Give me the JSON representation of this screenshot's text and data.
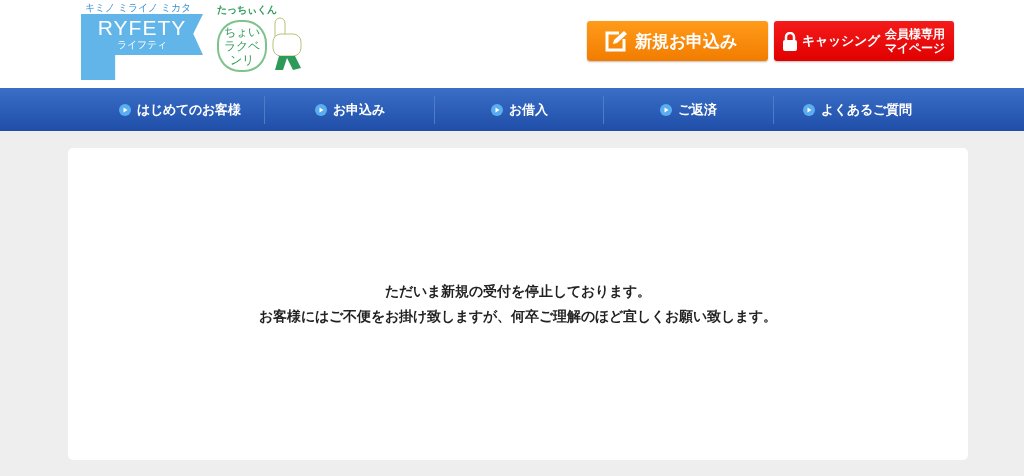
{
  "logo": {
    "tagline": "キミノ ミライノ ミカタ",
    "wordmark": "RYFETY",
    "kana": "ライフティ"
  },
  "mascot": {
    "name": "たっちぃくん",
    "speech": "ちょいラクベンリ"
  },
  "header_buttons": [
    {
      "kind": "apply",
      "label": "新規お申込み"
    },
    {
      "kind": "member",
      "label": "キャッシング",
      "sub": [
        "会員様専用",
        "マイページ"
      ]
    }
  ],
  "nav": [
    {
      "label": "はじめてのお客様"
    },
    {
      "label": "お申込み"
    },
    {
      "label": "お借入"
    },
    {
      "label": "ご返済"
    },
    {
      "label": "よくあるご質問"
    }
  ],
  "notice": [
    "ただいま新規の受付を停止しております。",
    "お客様にはご不便をお掛け致しますが、何卒ご理解のほど宜しくお願い致します。"
  ]
}
